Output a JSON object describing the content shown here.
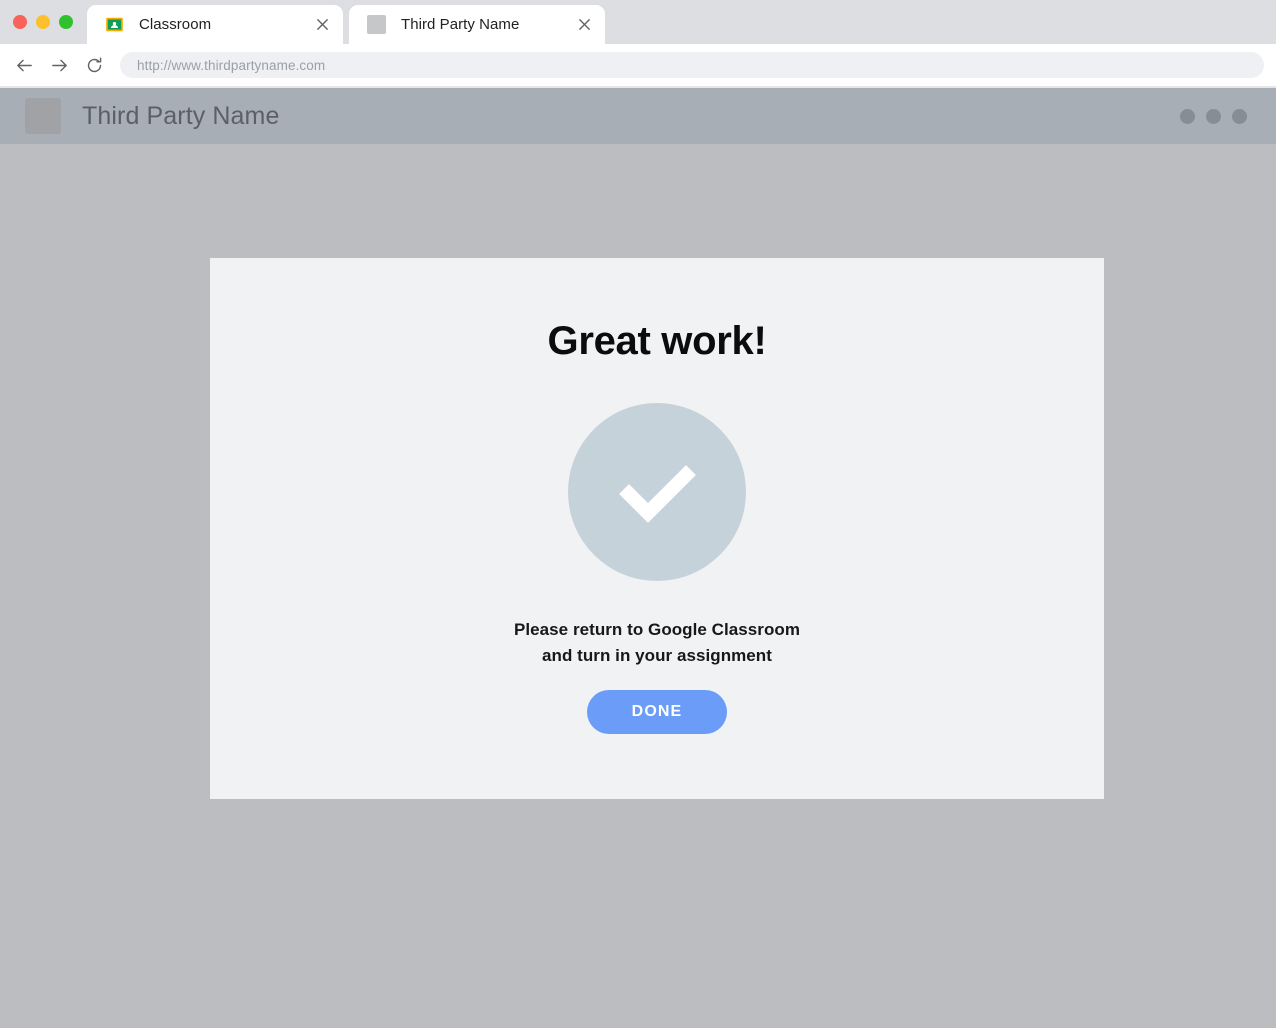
{
  "browser": {
    "window_controls": [
      {
        "name": "close",
        "color": "#f9615b"
      },
      {
        "name": "minimize",
        "color": "#fcc02e"
      },
      {
        "name": "maximize",
        "color": "#2fc12e"
      }
    ],
    "tabs": [
      {
        "title": "Classroom",
        "favicon": "google-classroom-icon",
        "close_label": "×",
        "active": true
      },
      {
        "title": "Third Party Name",
        "favicon": "placeholder-favicon",
        "close_label": "×",
        "active": false
      }
    ],
    "toolbar": {
      "back_icon": "arrow-left-icon",
      "forward_icon": "arrow-right-icon",
      "reload_icon": "reload-icon",
      "url": "http://www.thirdpartyname.com"
    }
  },
  "site": {
    "header": {
      "logo": "placeholder-logo",
      "title": "Third Party Name",
      "menu_icon": "three-dots-icon",
      "background_color": "#a8aeb6"
    },
    "card": {
      "heading": "Great work!",
      "status_icon": "checkmark-circle-icon",
      "status_icon_color": "#c6d2da",
      "message_line_1": "Please return to Google Classroom",
      "message_line_2": "and turn in your assignment",
      "done_button_label": "DONE",
      "done_button_color": "#6b9cf7"
    }
  }
}
